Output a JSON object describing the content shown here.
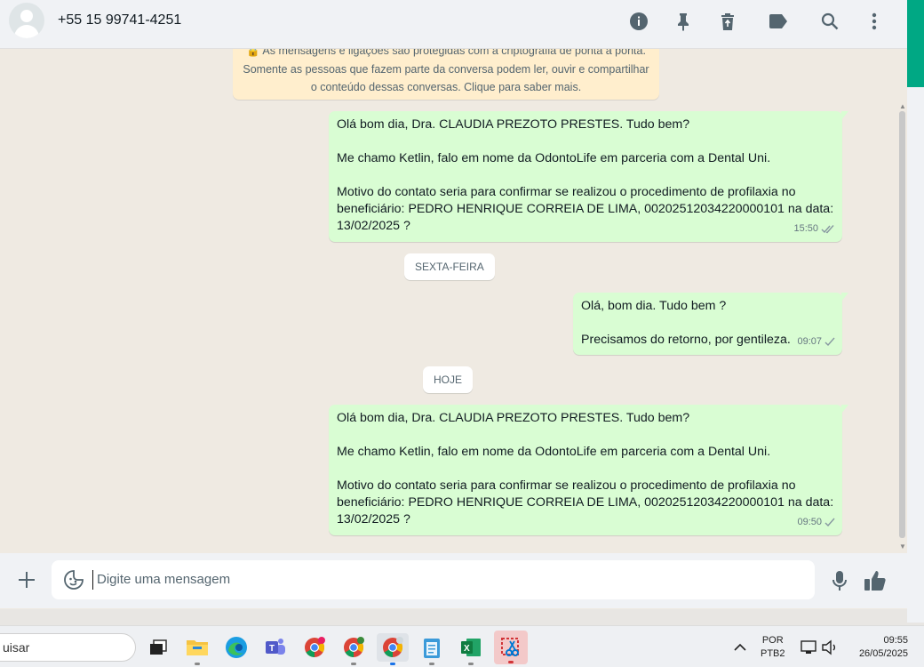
{
  "header": {
    "contact_name": "+55 15 99741-4251"
  },
  "notice": {
    "line1": "🔒 As mensagens e ligações são protegidas com a criptografia de ponta a ponta.",
    "line2": "Somente as pessoas que fazem parte da conversa podem ler, ouvir e compartilhar",
    "line3": "o conteúdo dessas conversas. Clique para saber mais."
  },
  "messages": [
    {
      "text": "Olá bom dia, Dra. CLAUDIA PREZOTO PRESTES. Tudo bem?\n\nMe chamo Ketlin, falo em nome da OdontoLife em parceria com a Dental Uni.\n\nMotivo do contato seria para confirmar se realizou o procedimento de profilaxia no beneficiário: PEDRO HENRIQUE CORREIA DE LIMA, 00202512034220000101 na data: 13/02/2025 ?",
      "time": "15:50",
      "status": "read"
    },
    {
      "text": "Olá, bom dia. Tudo bem ?\n\nPrecisamos do retorno, por gentileza.",
      "time": "09:07",
      "status": "delivered"
    },
    {
      "text": "Olá bom dia, Dra. CLAUDIA PREZOTO PRESTES. Tudo bem?\n\nMe chamo Ketlin, falo em nome da OdontoLife em parceria com a Dental Uni.\n\nMotivo do contato seria para confirmar se realizou o procedimento de profilaxia no beneficiário: PEDRO HENRIQUE CORREIA DE LIMA, 00202512034220000101 na data: 13/02/2025 ?",
      "time": "09:50",
      "status": "delivered"
    }
  ],
  "date_chips": {
    "friday": "SEXTA-FEIRA",
    "today": "HOJE"
  },
  "composer": {
    "placeholder": "Digite uma mensagem"
  },
  "taskbar": {
    "search_text": "uisar",
    "lang_line1": "POR",
    "lang_line2": "PTB2",
    "time": "09:55",
    "date": "26/05/2025"
  },
  "colors": {
    "bubble_out": "#d9fdd3",
    "chat_bg": "#efeae2",
    "notice_bg": "#ffeecd",
    "accent": "#00a884"
  }
}
